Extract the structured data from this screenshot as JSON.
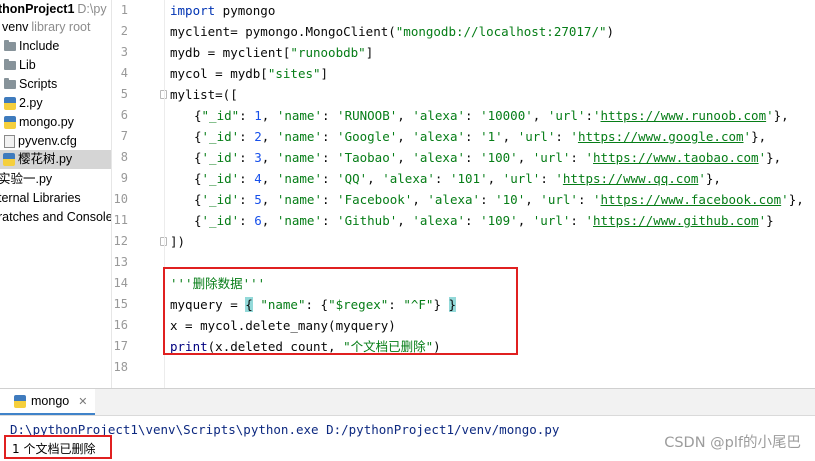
{
  "sidebar": {
    "project_name": "thonProject1",
    "project_path": "D:\\py",
    "items": [
      {
        "label": "venv",
        "note": "library root"
      },
      {
        "label": "Include"
      },
      {
        "label": "Lib"
      },
      {
        "label": "Scripts"
      },
      {
        "label": "2.py"
      },
      {
        "label": "mongo.py"
      },
      {
        "label": "pyvenv.cfg"
      },
      {
        "label": "樱花树.py"
      },
      {
        "label": "实验一.py"
      },
      {
        "label": "ternal Libraries"
      },
      {
        "label": "ratches and Console"
      }
    ]
  },
  "editor": {
    "line_numbers": [
      "1",
      "2",
      "3",
      "4",
      "5",
      "6",
      "7",
      "8",
      "9",
      "10",
      "11",
      "12",
      "13",
      "14",
      "15",
      "16",
      "17",
      "18"
    ],
    "lines": [
      "import pymongo",
      "myclient= pymongo.MongoClient(\"mongodb://localhost:27017/\")",
      "mydb = myclient[\"runoobdb\"]",
      "mycol = mydb[\"sites\"]",
      "mylist=([",
      "{\"_id\": 1, 'name': 'RUNOOB', 'alexa': '10000', 'url':'https://www.runoob.com'},",
      "{'_id': 2, 'name': 'Google', 'alexa': '1', 'url': 'https://www.google.com'},",
      "{'_id': 3, 'name': 'Taobao', 'alexa': '100', 'url': 'https://www.taobao.com'},",
      "{'_id': 4, 'name': 'QQ', 'alexa': '101', 'url': 'https://www.qq.com'},",
      "{'_id': 5, 'name': 'Facebook', 'alexa': '10', 'url': 'https://www.facebook.com'},",
      "{'_id': 6, 'name': 'Github', 'alexa': '109', 'url': 'https://www.github.com'}",
      "])",
      "",
      "'''删除数据'''",
      "myquery = { \"name\": {\"$regex\": \"^F\"} }",
      "x = mycol.delete_many(myquery)",
      "print(x.deleted_count, \"个文档已删除\")",
      ""
    ]
  },
  "run": {
    "tab_label": "mongo",
    "command": "D:\\pythonProject1\\venv\\Scripts\\python.exe D:/pythonProject1/venv/mongo.py",
    "output": "1 个文档已删除"
  },
  "watermark": "CSDN @plf的小尾巴"
}
